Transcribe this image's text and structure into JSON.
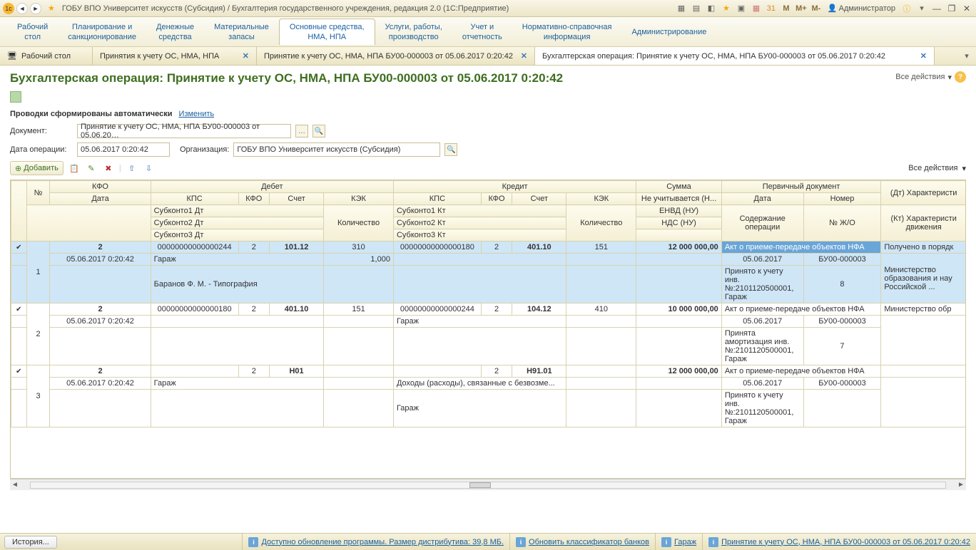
{
  "titlebar": {
    "title": "ГОБУ ВПО Университет искусств (Субсидия) / Бухгалтерия государственного учреждения, редакция 2.0   (1С:Предприятие)",
    "m1": "М",
    "m2": "М+",
    "m3": "М-",
    "user": "Администратор"
  },
  "menu": [
    "Рабочий\nстол",
    "Планирование и\nсанкционирование",
    "Денежные\nсредства",
    "Материальные\nзапасы",
    "Основные средства,\nНМА, НПА",
    "Услуги, работы,\nпроизводство",
    "Учет и\nотчетность",
    "Нормативно-справочная\nинформация",
    "Администрирование"
  ],
  "menu_active_index": 4,
  "tabs": [
    {
      "label": "Рабочий стол",
      "closable": false
    },
    {
      "label": "Принятия к учету ОС, НМА, НПА",
      "closable": true
    },
    {
      "label": "Принятие к учету ОС, НМА, НПА БУ00-000003 от 05.06.2017 0:20:42",
      "closable": true
    },
    {
      "label": "Бухгалтерская операция: Принятие к учету ОС, НМА, НПА БУ00-000003 от 05.06.2017 0:20:42",
      "closable": true
    }
  ],
  "tab_active_index": 3,
  "page": {
    "title": "Бухгалтерская операция: Принятие к учету ОС, НМА, НПА БУ00-000003 от 05.06.2017 0:20:42",
    "all_actions": "Все действия",
    "auto_msg": "Проводки сформированы автоматически",
    "change_link": "Изменить",
    "doc_label": "Документ:",
    "doc_value": "Принятие к учету ОС, НМА, НПА БУ00-000003 от 05.06.20…",
    "date_label": "Дата операции:",
    "date_value": "05.06.2017  0:20:42",
    "org_label": "Организация:",
    "org_value": "ГОБУ ВПО Университет искусств (Субсидия)",
    "add_btn": "Добавить",
    "all_actions2": "Все действия"
  },
  "grid": {
    "headers": {
      "num": "№",
      "kfo": "КФО",
      "date": "Дата",
      "debit": "Дебет",
      "credit": "Кредит",
      "kps": "КПС",
      "kfo2": "КФО",
      "account": "Счет",
      "kek": "КЭК",
      "sub1dt": "Субконто1 Дт",
      "sub2dt": "Субконто2 Дт",
      "sub3dt": "Субконто3 Дт",
      "qty": "Количество",
      "sub1kt": "Субконто1 Кт",
      "sub2kt": "Субконто2 Кт",
      "sub3kt": "Субконто3 Кт",
      "sum": "Сумма",
      "not_counted": "Не учитывается (Н...",
      "envd": "ЕНВД (НУ)",
      "nds": "НДС (НУ)",
      "primary_doc": "Первичный документ",
      "doc_date": "Дата",
      "doc_num": "Номер",
      "op_content": "Содержание операции",
      "journal": "№ Ж/О",
      "dt_char": "(Дт) Характеристи",
      "kt_char": "(Кт) Характеристи",
      "movement": "движения"
    },
    "rows": [
      {
        "n": "1",
        "kfo_top": "2",
        "date": "05.06.2017 0:20:42",
        "d_kps": "00000000000000244",
        "d_kfo": "2",
        "d_acc": "101.12",
        "d_kek": "310",
        "d_qty": "1,000",
        "d_sub1": "Гараж",
        "d_sub2": "Баранов Ф. М. - Типография",
        "c_kps": "00000000000000180",
        "c_kfo": "2",
        "c_acc": "401.10",
        "c_kek": "151",
        "sum": "12 000 000,00",
        "pd_name": "Акт о приеме-передаче объектов НФА",
        "pd_date": "05.06.2017",
        "pd_num": "БУ00-000003",
        "content": "Принято к учету инв. №:2101120500001, Гараж",
        "journal": "8",
        "dt_char": "Получено в порядк",
        "kt_char": "Министерство образования и нау Российской ..."
      },
      {
        "n": "2",
        "kfo_top": "2",
        "date": "05.06.2017 0:20:42",
        "d_kps": "00000000000000180",
        "d_kfo": "2",
        "d_acc": "401.10",
        "d_kek": "151",
        "c_kps": "00000000000000244",
        "c_kfo": "2",
        "c_acc": "104.12",
        "c_kek": "410",
        "c_sub1": "Гараж",
        "sum": "10 000 000,00",
        "pd_name": "Акт о приеме-передаче объектов НФА",
        "pd_date": "05.06.2017",
        "pd_num": "БУ00-000003",
        "content": "Принята амортизация инв. №:2101120500001, Гараж",
        "journal": "7",
        "dt_char": "Министерство обр"
      },
      {
        "n": "3",
        "kfo_top": "2",
        "date": "05.06.2017 0:20:42",
        "d_kfo": "2",
        "d_acc": "Н01",
        "d_sub1": "Гараж",
        "c_kfo": "2",
        "c_acc": "Н91.01",
        "c_sub1": "Доходы (расходы), связанные с безвозме...",
        "c_sub2": "Гараж",
        "sum": "12 000 000,00",
        "pd_name": "Акт о приеме-передаче объектов НФА",
        "pd_date": "05.06.2017",
        "pd_num": "БУ00-000003",
        "content": "Принято к учету инв. №:2101120500001, Гараж"
      }
    ]
  },
  "status": {
    "history": "История...",
    "update": "Доступно обновление программы. Размер дистрибутива: 39,8 МБ.",
    "bank": "Обновить классификатор банков",
    "garage": "Гараж",
    "doc": "Принятие к учету ОС, НМА, НПА БУ00-000003 от 05.06.2017 0:20:42"
  }
}
